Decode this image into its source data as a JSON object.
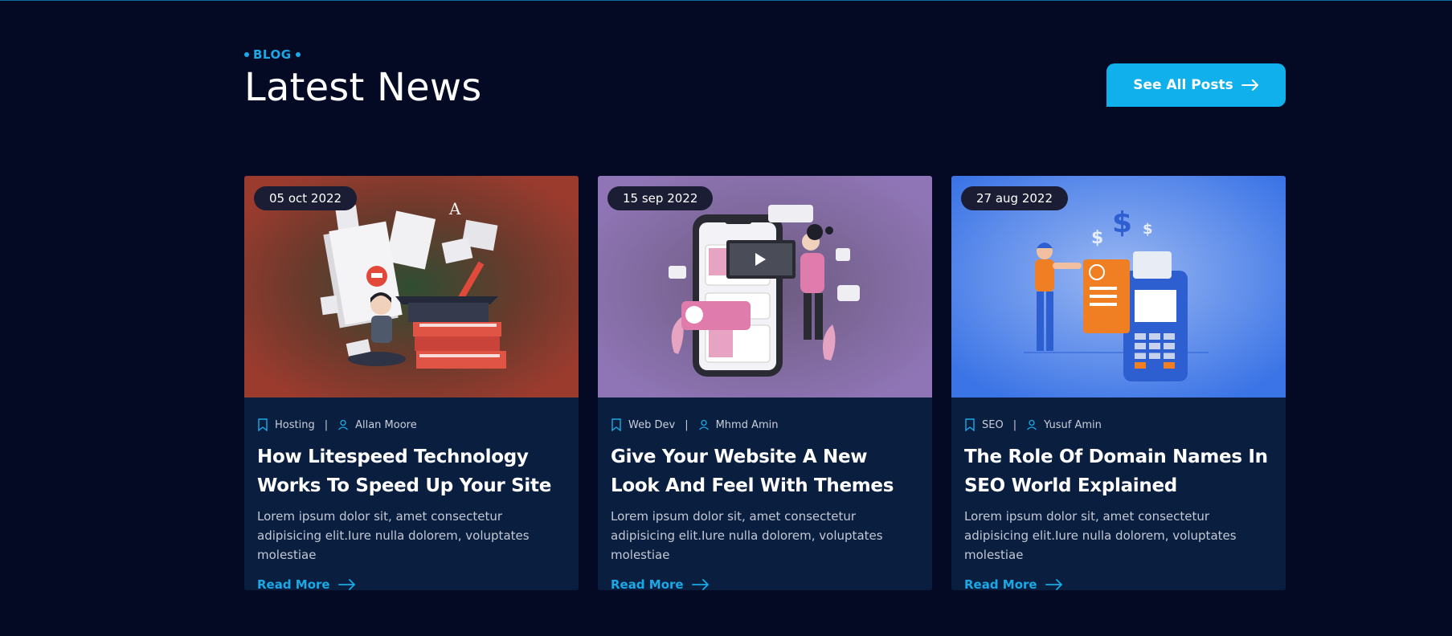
{
  "header": {
    "eyebrow": "BLOG",
    "title": "Latest News",
    "cta_label": "See All Posts"
  },
  "colors": {
    "background": "#040a24",
    "accent": "#10b0ec",
    "card": "#0a1f40"
  },
  "posts": [
    {
      "date": "05 oct 2022",
      "category": "Hosting",
      "author": "Allan Moore",
      "title": "How Litespeed Technology Works To Speed Up Your Site",
      "excerpt": "Lorem ipsum dolor sit, amet consectetur adipisicing elit.Iure nulla dolorem, voluptates molestiae",
      "read_more": "Read More",
      "illustration": "student-with-books-illustration"
    },
    {
      "date": "15 sep 2022",
      "category": "Web Dev",
      "author": "Mhmd Amin",
      "title": "Give Your Website A New Look And Feel With Themes",
      "excerpt": "Lorem ipsum dolor sit, amet consectetur adipisicing elit.Iure nulla dolorem, voluptates molestiae",
      "read_more": "Read More",
      "illustration": "mobile-social-media-illustration"
    },
    {
      "date": "27 aug 2022",
      "category": "SEO",
      "author": "Yusuf Amin",
      "title": "The Role Of Domain Names In SEO World Explained",
      "excerpt": "Lorem ipsum dolor sit, amet consectetur adipisicing elit.Iure nulla dolorem, voluptates molestiae",
      "read_more": "Read More",
      "illustration": "card-payment-terminal-illustration"
    }
  ]
}
